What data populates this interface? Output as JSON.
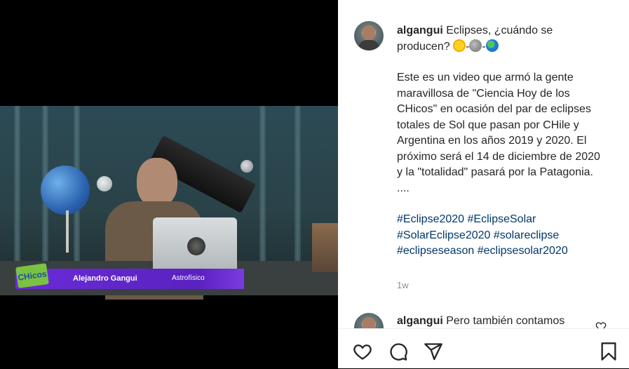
{
  "video": {
    "lower_third": {
      "logo_text": "CHicos",
      "name": "Alejandro Gangui",
      "role": "Astrofísico"
    }
  },
  "post": {
    "username": "algangui",
    "caption_title": "Eclipses, ¿cuándo se producen?",
    "caption_emoji_separator": "-",
    "caption_body": "Este es un video que armó la gente maravillosa de \"Ciencia Hoy de los CHicos\" en ocasión del par de eclipses totales de Sol que pasan por CHile y Argentina en los años 2019 y 2020. El próximo será el 14 de diciembre de 2020 y la \"totalidad\" pasará por la Patagonia.",
    "caption_ellipsis": "....",
    "hashtags": [
      "#Eclipse2020",
      "#EclipseSolar",
      "#SolarEclipse2020",
      "#solareclipse",
      "#eclipseseason",
      "#eclipsesolar2020"
    ],
    "time_ago": "1w"
  },
  "comment": {
    "username": "algangui",
    "text": "Pero también contamos"
  },
  "icons": {
    "like": "heart-icon",
    "comment": "comment-icon",
    "share": "share-icon",
    "save": "bookmark-icon"
  }
}
